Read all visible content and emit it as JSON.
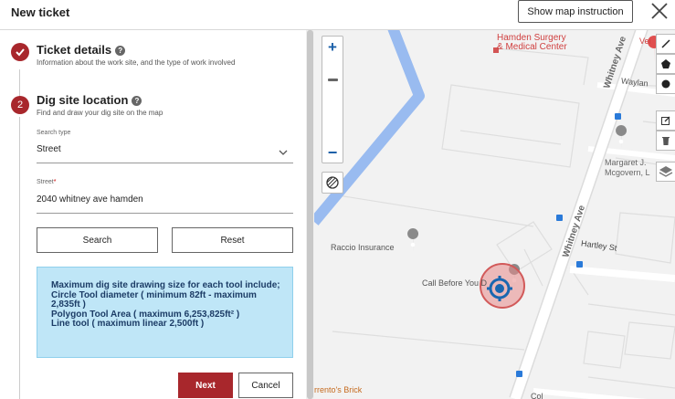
{
  "header": {
    "title": "New ticket",
    "map_instruction_label": "Show map instruction"
  },
  "steps": [
    {
      "number": "",
      "title": "Ticket details",
      "subtitle": "Information about the work site, and the type of work involved",
      "status": "complete"
    },
    {
      "number": "2",
      "title": "Dig site location",
      "subtitle": "Find and draw your dig site on the map",
      "status": "active"
    }
  ],
  "form": {
    "search_type": {
      "label": "Search type",
      "value": "Street"
    },
    "street": {
      "label": "Street",
      "required_mark": "*",
      "value": "2040 whitney ave hamden"
    },
    "search_label": "Search",
    "reset_label": "Reset"
  },
  "info": {
    "text": "Maximum dig site drawing size for each tool include;\nCircle Tool diameter ( minimum 82ft - maximum 2,835ft )\nPolygon Tool Area ( maximum 6,253,825ft² )\nLine tool ( maximum linear 2,500ft )"
  },
  "actions": {
    "next_label": "Next",
    "cancel_label": "Cancel"
  },
  "map": {
    "labels": {
      "hamden_surgery": "Hamden Surgery\n& Medical Center",
      "whitney_ave_top": "Whitney Ave",
      "whitney_ave_mid": "Whitney Ave",
      "wayland": "Waylan",
      "margaret": "Margaret J.\nMcgovern, L",
      "raccio": "Raccio Insurance",
      "hartley": "Hartley St",
      "call_before": "Call Before You D",
      "rentos": "rrento's Brick",
      "vei": "Vei",
      "col": "Col"
    },
    "zoom_plus": "+",
    "zoom_minus": "−",
    "colors": {
      "water": "#99bbf0",
      "road": "#ffffff",
      "pin": "#a8272c",
      "locator": "#1a67b0"
    }
  }
}
